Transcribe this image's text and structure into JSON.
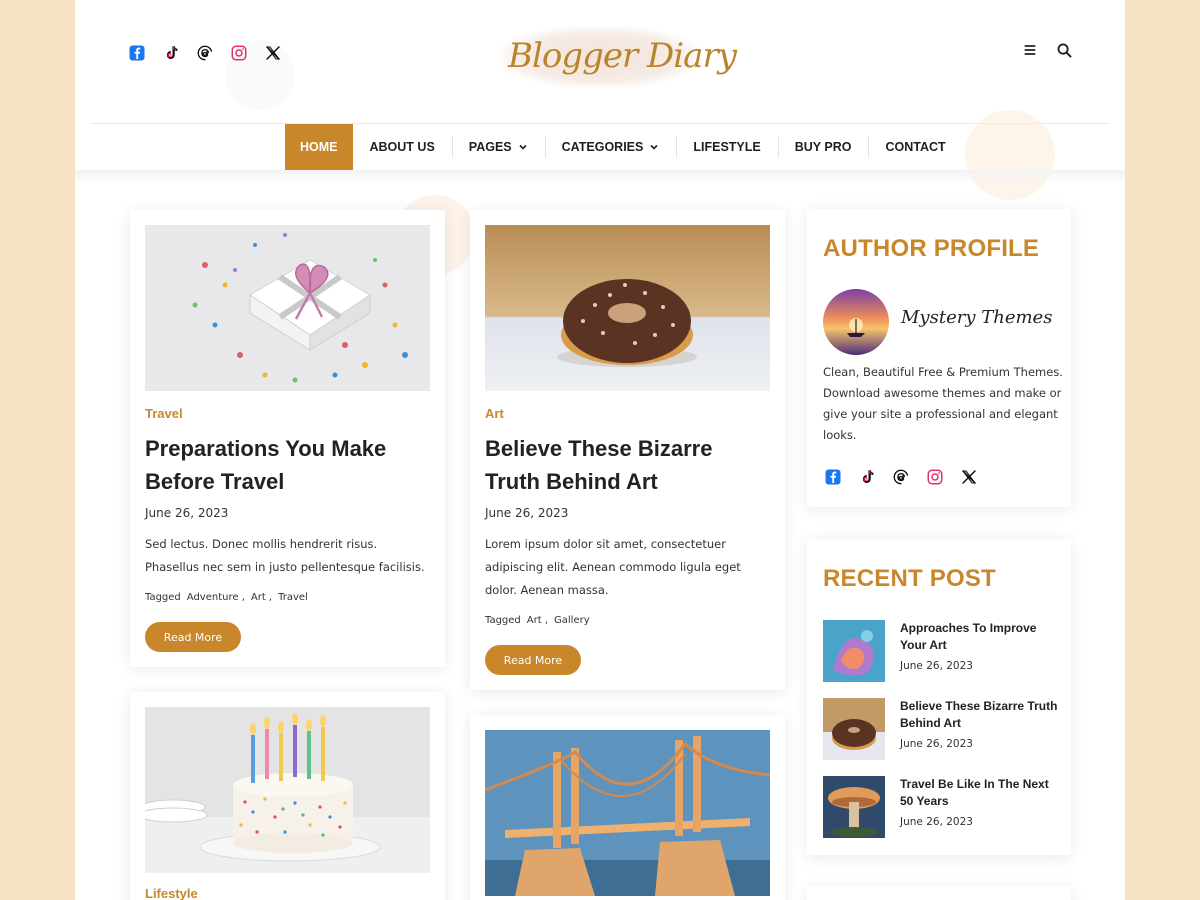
{
  "brand": {
    "logo_text": "Blogger Diary",
    "accent": "#c8872a",
    "page_bg": "#f6e3c4"
  },
  "header": {
    "social_icons": [
      "facebook-icon",
      "tiktok-icon",
      "threads-icon",
      "instagram-icon",
      "x-icon"
    ],
    "tools": [
      "menu-icon",
      "search-icon"
    ]
  },
  "nav": {
    "items": [
      {
        "label": "HOME",
        "active": true,
        "has_dropdown": false
      },
      {
        "label": "ABOUT US",
        "active": false,
        "has_dropdown": false
      },
      {
        "label": "PAGES",
        "active": false,
        "has_dropdown": true
      },
      {
        "label": "CATEGORIES",
        "active": false,
        "has_dropdown": true
      },
      {
        "label": "LIFESTYLE",
        "active": false,
        "has_dropdown": false
      },
      {
        "label": "BUY PRO",
        "active": false,
        "has_dropdown": false
      },
      {
        "label": "CONTACT",
        "active": false,
        "has_dropdown": false
      }
    ]
  },
  "posts": [
    {
      "category": "Travel",
      "title": "Preparations You Make Before Travel",
      "date": "June 26, 2023",
      "excerpt": "Sed lectus. Donec mollis hendrerit risus. Phasellus nec sem in justo pellentesque facilisis.",
      "tagged_label": "Tagged",
      "tags": [
        "Adventure",
        "Art",
        "Travel"
      ],
      "button": "Read More",
      "image": "gift-box-image"
    },
    {
      "category": "Art",
      "title": "Believe These Bizarre Truth Behind Art",
      "date": "June 26, 2023",
      "excerpt": "Lorem ipsum dolor sit amet, consectetuer adipiscing elit. Aenean commodo ligula eget dolor. Aenean massa.",
      "tagged_label": "Tagged",
      "tags": [
        "Art",
        "Gallery"
      ],
      "button": "Read More",
      "image": "donut-image"
    },
    {
      "category": "Lifestyle",
      "image": "birthday-cake-image"
    },
    {
      "image": "bridge-image"
    }
  ],
  "sidebar": {
    "author_profile": {
      "title": "AUTHOR PROFILE",
      "name": "Mystery Themes",
      "description": "Clean, Beautiful Free & Premium Themes. Download awesome themes and make or give your site a professional and elegant looks.",
      "social_icons": [
        "facebook-icon",
        "tiktok-icon",
        "threads-icon",
        "instagram-icon",
        "x-icon"
      ]
    },
    "recent_post": {
      "title": "RECENT POST",
      "items": [
        {
          "title": "Approaches To Improve Your Art",
          "date": "June 26, 2023",
          "thumb": "paint-splash-thumb"
        },
        {
          "title": "Believe These Bizarre Truth Behind Art",
          "date": "June 26, 2023",
          "thumb": "donut-thumb"
        },
        {
          "title": "Travel Be Like In The Next 50 Years",
          "date": "June 26, 2023",
          "thumb": "mushroom-thumb"
        }
      ]
    }
  }
}
